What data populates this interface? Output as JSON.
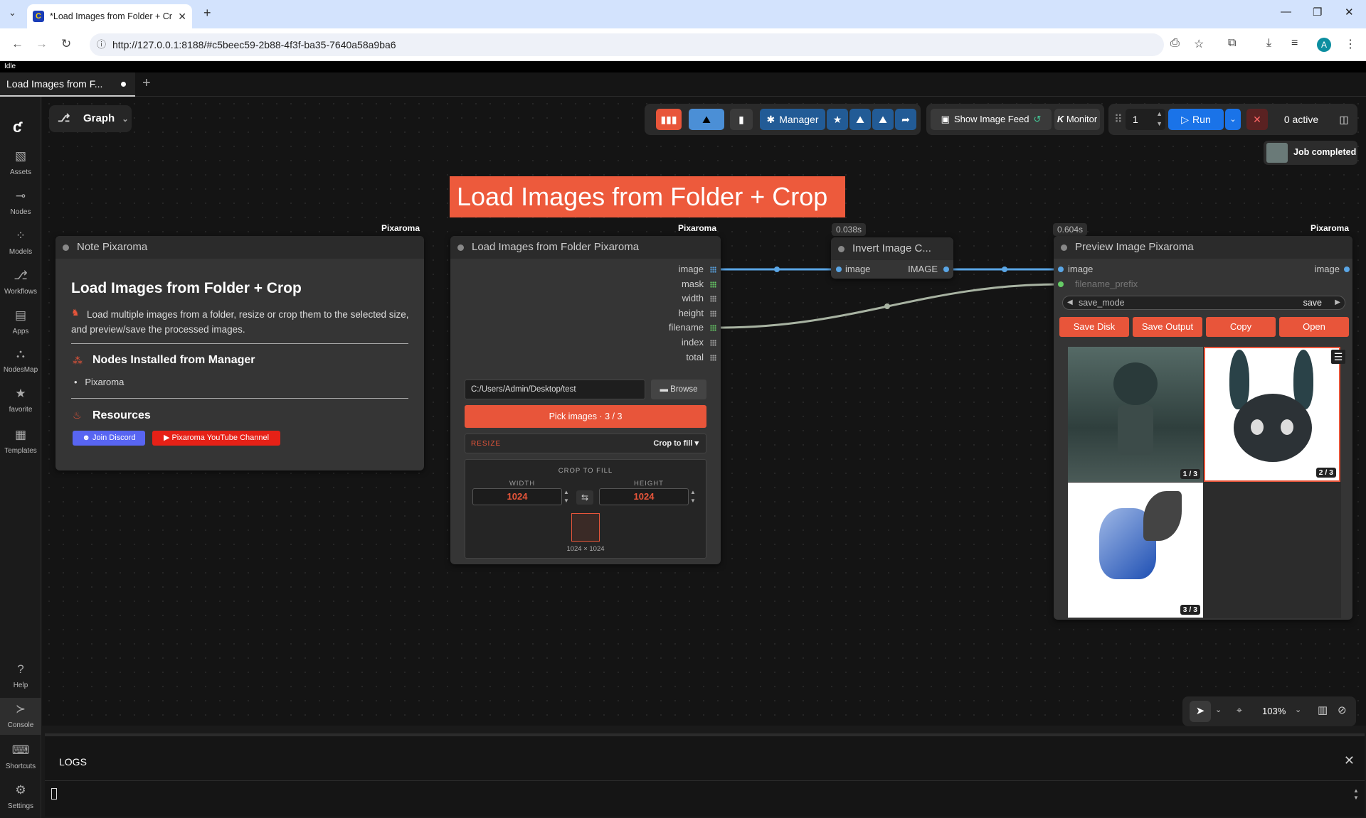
{
  "browser": {
    "tab_title": "*Load Images from Folder + Cr",
    "url": "http://127.0.0.1:8188/#c5beec59-2b88-4f3f-ba35-7640a58a9ba6",
    "profile_initial": "A"
  },
  "app": {
    "status": "Idle",
    "workflow_tab": "Load Images from F...",
    "sidebar": [
      {
        "label": "Assets",
        "icon": "image-icon"
      },
      {
        "label": "Nodes",
        "icon": "node-icon"
      },
      {
        "label": "Models",
        "icon": "cube-icon"
      },
      {
        "label": "Workflows",
        "icon": "workflow-icon"
      },
      {
        "label": "Apps",
        "icon": "apps-icon"
      },
      {
        "label": "NodesMap",
        "icon": "map-icon"
      },
      {
        "label": "favorite",
        "icon": "star-icon"
      },
      {
        "label": "Templates",
        "icon": "templates-icon"
      }
    ],
    "sidebar_bottom": [
      {
        "label": "Help",
        "icon": "help-icon"
      },
      {
        "label": "Console",
        "icon": "console-icon"
      },
      {
        "label": "Shortcuts",
        "icon": "keyboard-icon"
      },
      {
        "label": "Settings",
        "icon": "gear-icon"
      }
    ],
    "graph_label": "Graph",
    "toolbar": {
      "manager": "Manager",
      "show_image_feed": "Show Image Feed",
      "monitor": "Monitor",
      "batch_count": "1",
      "run": "Run",
      "active": "0 active"
    },
    "job_completed": "Job completed",
    "group_title": "Load Images from Folder + Crop",
    "note_node": {
      "badge": "Pixaroma",
      "title": "Note Pixaroma",
      "heading": "Load Images from Folder + Crop",
      "description": "Load multiple images from a folder, resize or crop them to the selected size, and preview/save the processed images.",
      "nodes_heading": "Nodes Installed from Manager",
      "nodes_list": [
        "Pixaroma"
      ],
      "resources_heading": "Resources",
      "discord_btn": "Join Discord",
      "youtube_btn": "Pixaroma YouTube Channel"
    },
    "load_node": {
      "badge": "Pixaroma",
      "title": "Load Images from Folder Pixaroma",
      "outputs": [
        "image",
        "mask",
        "width",
        "height",
        "filename",
        "index",
        "total"
      ],
      "folder_path": "C:/Users/Admin/Desktop/test",
      "browse": "Browse",
      "pick_images": "Pick images · 3 / 3",
      "resize_label": "RESIZE",
      "resize_mode": "Crop to fill",
      "crop_heading": "CROP TO FILL",
      "width_label": "WIDTH",
      "height_label": "HEIGHT",
      "width": "1024",
      "height": "1024",
      "size_caption": "1024 × 1024"
    },
    "invert_node": {
      "time": "0.038s",
      "title": "Invert Image C...",
      "input": "image",
      "output": "IMAGE"
    },
    "preview_node": {
      "badge": "Pixaroma",
      "time": "0.604s",
      "title": "Preview Image Pixaroma",
      "input_image": "image",
      "input_filename": "filename_prefix",
      "output": "image",
      "save_mode_label": "save_mode",
      "save_mode_value": "save",
      "buttons": [
        "Save Disk",
        "Save Output",
        "Copy",
        "Open"
      ],
      "thumbs": [
        "1 / 3",
        "2 / 3",
        "3 / 3"
      ]
    },
    "bottom_controls": {
      "zoom": "103%"
    },
    "logs": {
      "title": "LOGS"
    }
  }
}
